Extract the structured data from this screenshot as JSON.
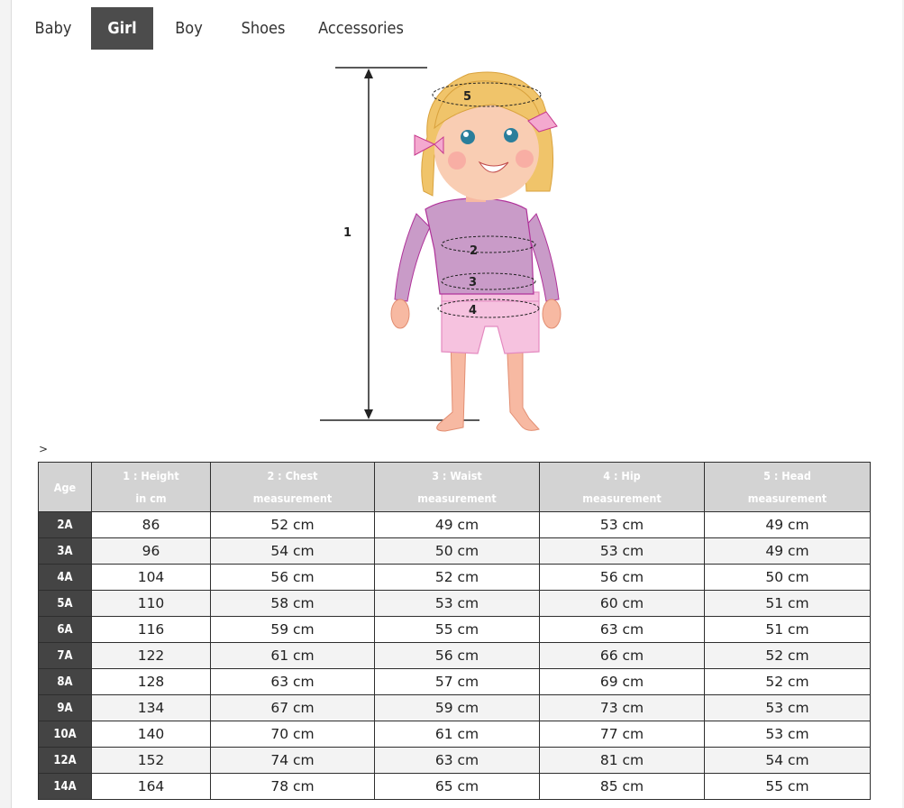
{
  "tabs": [
    {
      "label": "Baby"
    },
    {
      "label": "Girl",
      "active": true
    },
    {
      "label": "Boy"
    },
    {
      "label": "Shoes"
    },
    {
      "label": "Accessories"
    }
  ],
  "illustration": {
    "markers": [
      "1",
      "2",
      "3",
      "4",
      "5"
    ]
  },
  "caret": ">",
  "table": {
    "headers": [
      {
        "line1": "Age",
        "line2": ""
      },
      {
        "line1": "1 : Height",
        "line2": "in cm"
      },
      {
        "line1": "2 : Chest",
        "line2": "measurement"
      },
      {
        "line1": "3 : Waist",
        "line2": "measurement"
      },
      {
        "line1": "4 : Hip",
        "line2": "measurement"
      },
      {
        "line1": "5 : Head",
        "line2": "measurement"
      }
    ],
    "rows": [
      [
        "2A",
        "86",
        "52 cm",
        "49 cm",
        "53 cm",
        "49 cm"
      ],
      [
        "3A",
        "96",
        "54 cm",
        "50 cm",
        "53 cm",
        "49 cm"
      ],
      [
        "4A",
        "104",
        "56 cm",
        "52 cm",
        "56 cm",
        "50 cm"
      ],
      [
        "5A",
        "110",
        "58 cm",
        "53 cm",
        "60 cm",
        "51 cm"
      ],
      [
        "6A",
        "116",
        "59 cm",
        "55 cm",
        "63 cm",
        "51 cm"
      ],
      [
        "7A",
        "122",
        "61 cm",
        "56 cm",
        "66 cm",
        "52 cm"
      ],
      [
        "8A",
        "128",
        "63 cm",
        "57 cm",
        "69 cm",
        "52 cm"
      ],
      [
        "9A",
        "134",
        "67 cm",
        "59 cm",
        "73 cm",
        "53 cm"
      ],
      [
        "10A",
        "140",
        "70 cm",
        "61 cm",
        "77 cm",
        "53 cm"
      ],
      [
        "12A",
        "152",
        "74 cm",
        "63 cm",
        "81 cm",
        "54 cm"
      ],
      [
        "14A",
        "164",
        "78 cm",
        "65 cm",
        "85 cm",
        "55 cm"
      ]
    ]
  },
  "colors": {
    "tab_active": "#4c4c4c",
    "header_bg": "#d3d3d3",
    "age_bg": "#444444",
    "shirt": "#c99bc8",
    "shorts": "#f6c2df",
    "hair": "#f0c46a"
  }
}
